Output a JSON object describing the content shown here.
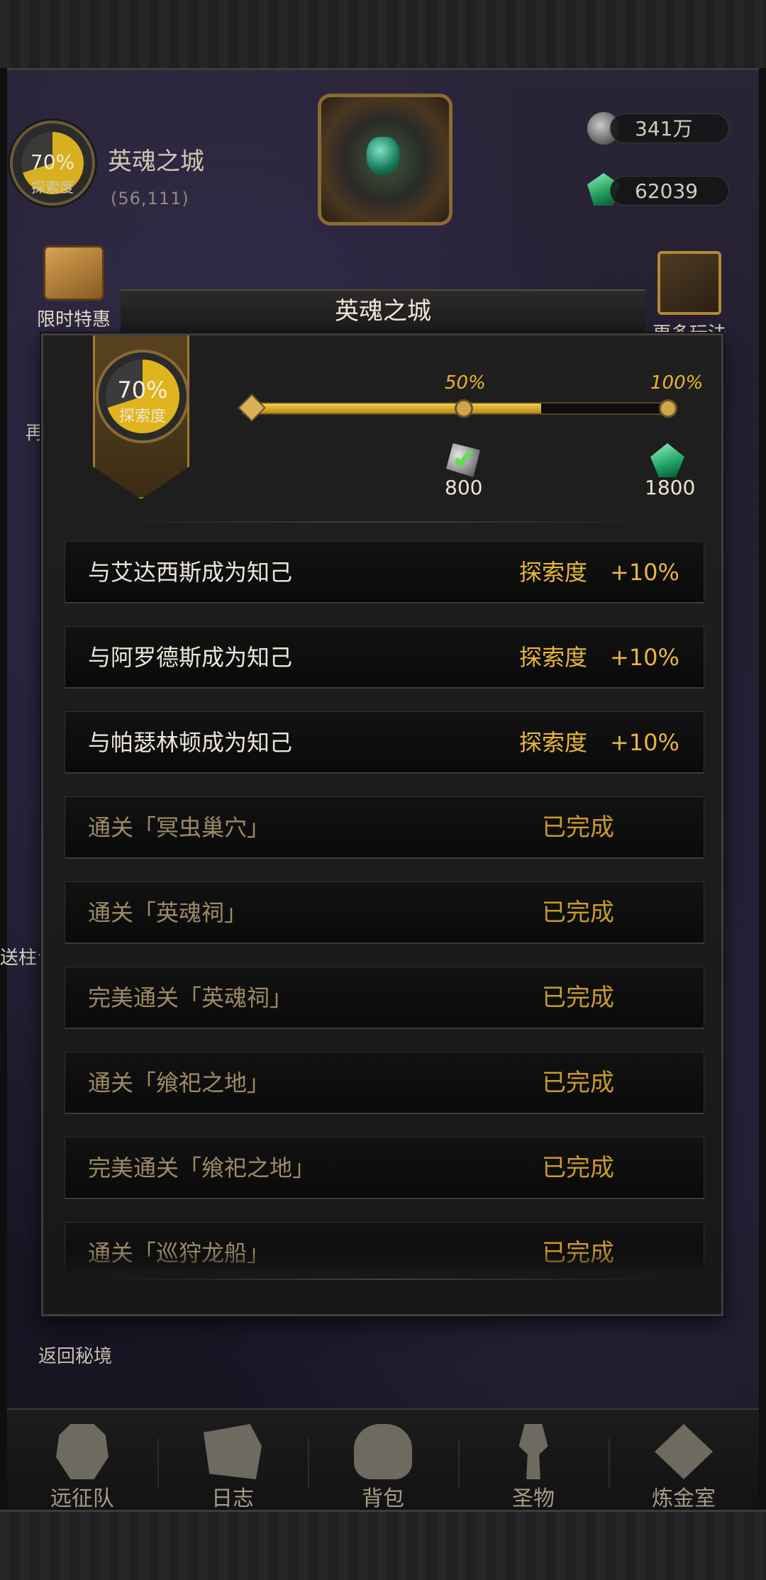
{
  "hud": {
    "progress_percent": "70%",
    "progress_label": "探索度",
    "zone_name": "英魂之城",
    "coordinates": "(56,111)"
  },
  "resources": {
    "stone_amount": "341万",
    "crystal_amount": "62039"
  },
  "side_buttons": {
    "limited_offer": "限时特惠",
    "more_play": "更多玩法",
    "left_cut_1": "再",
    "left_cut_2": "送柱台",
    "return_secret": "返回秘境"
  },
  "modal": {
    "title": "英魂之城",
    "progress_percent": "70%",
    "progress_label": "探索度",
    "progress_value": 70,
    "milestones": [
      {
        "percent": "50%",
        "reward": "800",
        "claimed": true
      },
      {
        "percent": "100%",
        "reward": "1800",
        "claimed": false
      }
    ],
    "tasks": [
      {
        "desc": "与艾达西斯成为知己",
        "reward": "探索度　+10%",
        "status": ""
      },
      {
        "desc": "与阿罗德斯成为知己",
        "reward": "探索度　+10%",
        "status": ""
      },
      {
        "desc": "与帕瑟林顿成为知己",
        "reward": "探索度　+10%",
        "status": ""
      },
      {
        "desc": "通关「冥虫巢穴」",
        "reward": "",
        "status": "已完成"
      },
      {
        "desc": "通关「英魂祠」",
        "reward": "",
        "status": "已完成"
      },
      {
        "desc": "完美通关「英魂祠」",
        "reward": "",
        "status": "已完成"
      },
      {
        "desc": "通关「飨祀之地」",
        "reward": "",
        "status": "已完成"
      },
      {
        "desc": "完美通关「飨祀之地」",
        "reward": "",
        "status": "已完成"
      },
      {
        "desc": "通关「巡狩龙船」",
        "reward": "",
        "status": "已完成"
      }
    ]
  },
  "bottom_nav": [
    {
      "label": "远征队",
      "icon": "helmet-icon"
    },
    {
      "label": "日志",
      "icon": "scroll-icon"
    },
    {
      "label": "背包",
      "icon": "bag-icon"
    },
    {
      "label": "圣物",
      "icon": "torch-icon"
    },
    {
      "label": "炼金室",
      "icon": "alchemy-icon"
    }
  ],
  "colors": {
    "gold": "#e8b52a",
    "done_text": "#9c8a66",
    "active_text": "#ece6da",
    "check_green": "#5fe04d"
  }
}
